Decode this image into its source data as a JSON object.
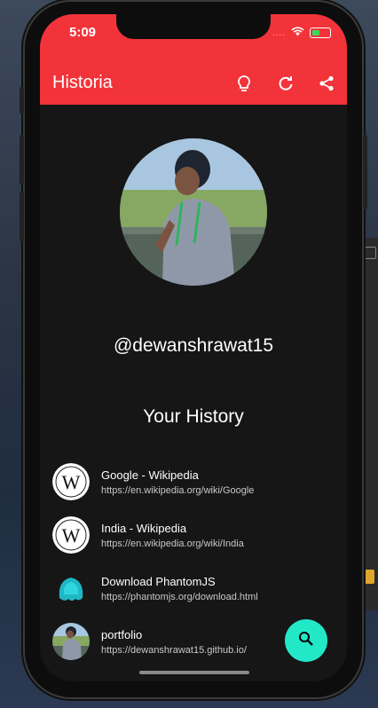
{
  "status": {
    "time": "5:09",
    "dots": "....",
    "wifi_icon": "wifi-icon",
    "battery_icon": "battery-icon"
  },
  "appbar": {
    "title": "Historia",
    "actions": [
      "lightbulb-icon",
      "refresh-icon",
      "share-icon"
    ]
  },
  "profile": {
    "handle": "@dewanshrawat15"
  },
  "history": {
    "heading": "Your History",
    "items": [
      {
        "title": "Google - Wikipedia",
        "url": "https://en.wikipedia.org/wiki/Google",
        "icon": "wikipedia-icon"
      },
      {
        "title": "India - Wikipedia",
        "url": "https://en.wikipedia.org/wiki/India",
        "icon": "wikipedia-icon"
      },
      {
        "title": "Download PhantomJS",
        "url": "https://phantomjs.org/download.html",
        "icon": "phantomjs-icon"
      },
      {
        "title": "portfolio",
        "url": "https://dewanshrawat15.github.io/",
        "icon": "avatar-icon"
      }
    ]
  },
  "fab": {
    "icon": "search-icon"
  },
  "colors": {
    "appbar": "#f2333a",
    "background": "#161616",
    "fab": "#22e8c8"
  }
}
